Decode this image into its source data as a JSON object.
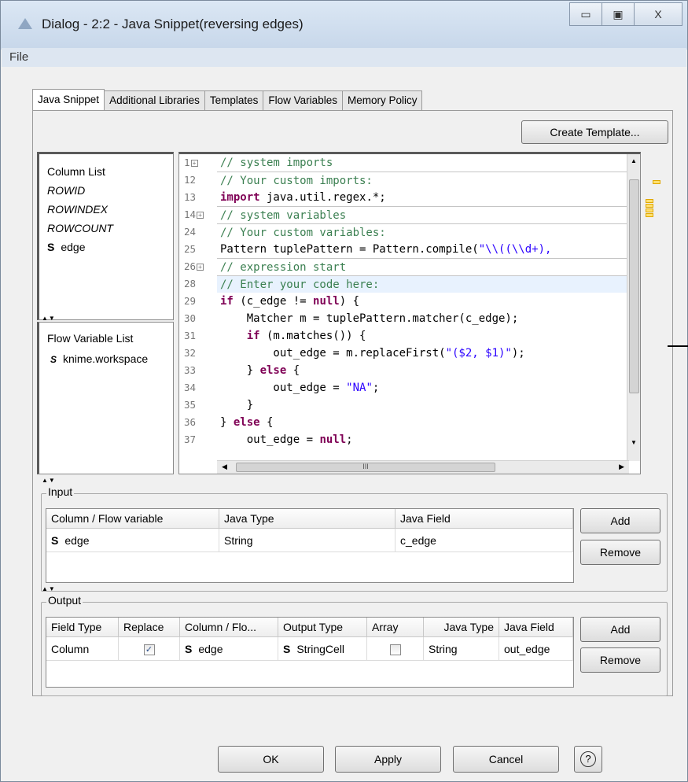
{
  "window": {
    "title": "Dialog - 2:2 - Java Snippet(reversing edges)",
    "minimize": "▭",
    "maximize": "▣",
    "close": "X"
  },
  "menu": {
    "file": "File"
  },
  "tabs": [
    "Java Snippet",
    "Additional Libraries",
    "Templates",
    "Flow Variables",
    "Memory Policy"
  ],
  "create_template": "Create Template...",
  "column_list": {
    "title": "Column List",
    "items": [
      "ROWID",
      "ROWINDEX",
      "ROWCOUNT"
    ],
    "typed_item": {
      "type": "S",
      "name": "edge"
    }
  },
  "flow_variable_list": {
    "title": "Flow Variable List",
    "item": {
      "type": "S",
      "name": "knime.workspace"
    }
  },
  "editor": {
    "line_numbers": [
      "1",
      "12",
      "13",
      "14",
      "24",
      "25",
      "26",
      "28",
      "29",
      "30",
      "31",
      "32",
      "33",
      "34",
      "35",
      "36",
      "37"
    ],
    "lines": [
      "// system imports",
      "// Your custom imports:",
      "import java.util.regex.*;",
      "// system variables",
      "// Your custom variables:",
      "Pattern tuplePattern = Pattern.compile(\"\\\\((\\\\d+),",
      "// expression start",
      "// Enter your code here:",
      "if (c_edge != null) {",
      "    Matcher m = tuplePattern.matcher(c_edge);",
      "    if (m.matches()) {",
      "        out_edge = m.replaceFirst(\"($2, $1)\");",
      "    } else {",
      "        out_edge = \"NA\";",
      "    }",
      "} else {",
      "    out_edge = null;"
    ],
    "hscroll_grip": "III"
  },
  "input": {
    "title": "Input",
    "columns": [
      "Column / Flow variable",
      "Java Type",
      "Java Field"
    ],
    "rows": [
      {
        "icon": "S",
        "column": "edge",
        "java_type": "String",
        "java_field": "c_edge"
      }
    ],
    "add": "Add",
    "remove": "Remove"
  },
  "output": {
    "title": "Output",
    "columns": [
      "Field Type",
      "Replace",
      "Column / Flo...",
      "Output Type",
      "Array",
      "Java Type",
      "Java Field"
    ],
    "rows": [
      {
        "field_type": "Column",
        "replace": true,
        "icon": "S",
        "column": "edge",
        "output_icon": "S",
        "output_type": "StringCell",
        "array": false,
        "java_type": "String",
        "java_field": "out_edge"
      }
    ],
    "add": "Add",
    "remove": "Remove"
  },
  "buttons": {
    "ok": "OK",
    "apply": "Apply",
    "cancel": "Cancel",
    "help": "?"
  }
}
